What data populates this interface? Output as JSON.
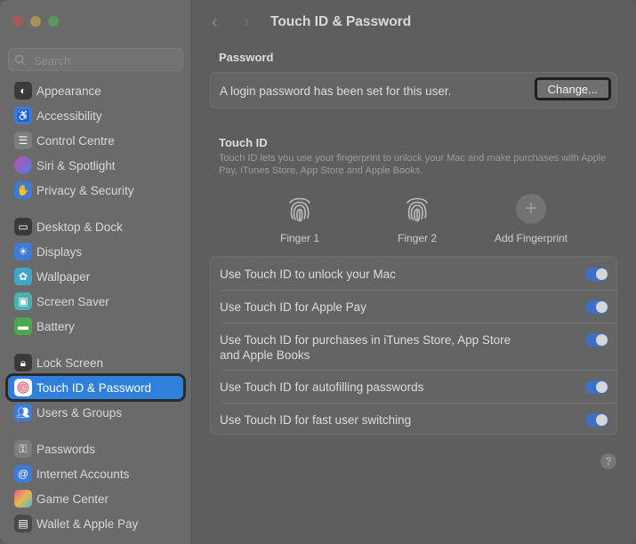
{
  "window": {
    "title": "Touch ID & Password"
  },
  "search": {
    "placeholder": "Search"
  },
  "sidebar": {
    "items": [
      {
        "label": "Appearance",
        "color": "#3a3a3a"
      },
      {
        "label": "Accessibility",
        "color": "#3d7bd6"
      },
      {
        "label": "Control Centre",
        "color": "#7d7d7d"
      },
      {
        "label": "Siri & Spotlight",
        "color": "#b04fa8"
      },
      {
        "label": "Privacy & Security",
        "color": "#3d7bd6"
      },
      {
        "label": "Desktop & Dock",
        "color": "#3a3a3a"
      },
      {
        "label": "Displays",
        "color": "#3d7bd6"
      },
      {
        "label": "Wallpaper",
        "color": "#3fa6c9"
      },
      {
        "label": "Screen Saver",
        "color": "#4fb0b0"
      },
      {
        "label": "Battery",
        "color": "#4aa64f"
      },
      {
        "label": "Lock Screen",
        "color": "#3a3a3a"
      },
      {
        "label": "Touch ID & Password",
        "color": "#ffffff",
        "active": true
      },
      {
        "label": "Users & Groups",
        "color": "#3d7bd6"
      },
      {
        "label": "Passwords",
        "color": "#7d7d7d"
      },
      {
        "label": "Internet Accounts",
        "color": "#3d7bd6"
      },
      {
        "label": "Game Center",
        "color": "#d8a04a"
      },
      {
        "label": "Wallet & Apple Pay",
        "color": "#4a4a4a"
      }
    ]
  },
  "password": {
    "section_title": "Password",
    "status_text": "A login password has been set for this user.",
    "change_label": "Change..."
  },
  "touch_id": {
    "section_title": "Touch ID",
    "description": "Touch ID lets you use your fingerprint to unlock your Mac and make purchases with Apple Pay, iTunes Store, App Store and Apple Books.",
    "fingers": [
      "Finger 1",
      "Finger 2"
    ],
    "add_label": "Add Fingerprint",
    "settings": [
      {
        "label": "Use Touch ID to unlock your Mac",
        "on": true
      },
      {
        "label": "Use Touch ID for Apple Pay",
        "on": true
      },
      {
        "label": "Use Touch ID for purchases in iTunes Store, App Store and Apple Books",
        "on": true
      },
      {
        "label": "Use Touch ID for autofilling passwords",
        "on": true
      },
      {
        "label": "Use Touch ID for fast user switching",
        "on": true
      }
    ]
  },
  "help": {
    "label": "?"
  },
  "colors": {
    "accent": "#2f7fdc",
    "toggle_on": "#3f70c4"
  }
}
